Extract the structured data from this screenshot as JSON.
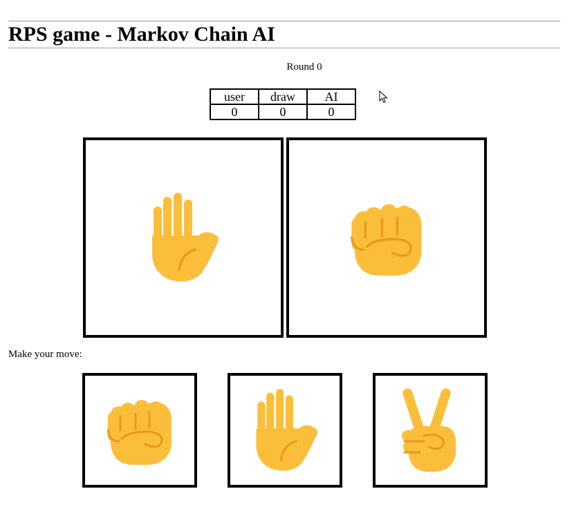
{
  "header": {
    "title": "RPS game - Markov Chain AI"
  },
  "round": {
    "label": "Round 0"
  },
  "scoreboard": {
    "headers": [
      "user",
      "draw",
      "AI"
    ],
    "values": [
      "0",
      "0",
      "0"
    ]
  },
  "arena": {
    "user_hand": "raised-hand-icon",
    "ai_hand": "raised-fist-icon"
  },
  "moves": {
    "prompt": "Make your move:",
    "options": [
      "rock",
      "paper",
      "scissors"
    ]
  },
  "colors": {
    "skin": "#FBBE3A",
    "crease": "#E59A1E",
    "border": "#000000"
  }
}
